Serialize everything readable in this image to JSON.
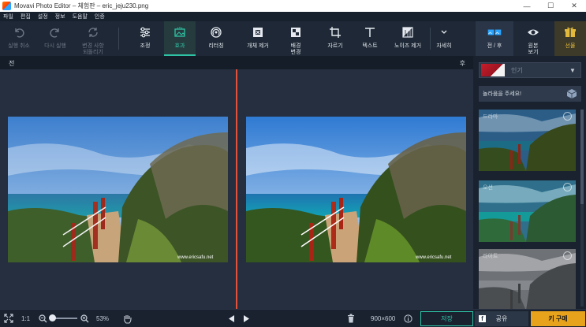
{
  "window": {
    "title": "Movavi Photo Editor – 체험판 – eric_jeju230.png",
    "controls": [
      "—",
      "☐",
      "✕"
    ]
  },
  "menu": [
    "파일",
    "편집",
    "설정",
    "정보",
    "도움말",
    "인증"
  ],
  "toolbar": {
    "undo": "실행 취소",
    "redo": "다시 실행",
    "reset_line1": "변경 사항",
    "reset_line2": "되돌리기",
    "adjust": "조정",
    "effects": "효과",
    "retouch": "리터칭",
    "object_removal": "개체 제거",
    "background_line1": "배경",
    "background_line2": "변경",
    "crop": "자르기",
    "text": "텍스트",
    "noise": "노이즈 제거",
    "more": "자세히",
    "before_after": "전 / 후",
    "view_line1": "원본",
    "view_line2": "보기",
    "gift": "선물"
  },
  "compare": {
    "before": "전",
    "after": "후"
  },
  "panel": {
    "filter_select": "인기",
    "surprise": "놀라움을 주세요!",
    "filters": [
      {
        "name": "드라마"
      },
      {
        "name": "오션"
      },
      {
        "name": "라이트"
      }
    ]
  },
  "bottombar": {
    "ratio": "1:1",
    "zoom": "53%",
    "image_size": "900×600",
    "save": "저장",
    "share": "공유",
    "buy": "키 구매",
    "facebook_glyph": "f"
  },
  "photo": {
    "watermark": "www.ericsafu.net"
  },
  "colors": {
    "accent": "#2fc3a5",
    "divider": "#e4523b",
    "buy": "#e8a31c"
  }
}
